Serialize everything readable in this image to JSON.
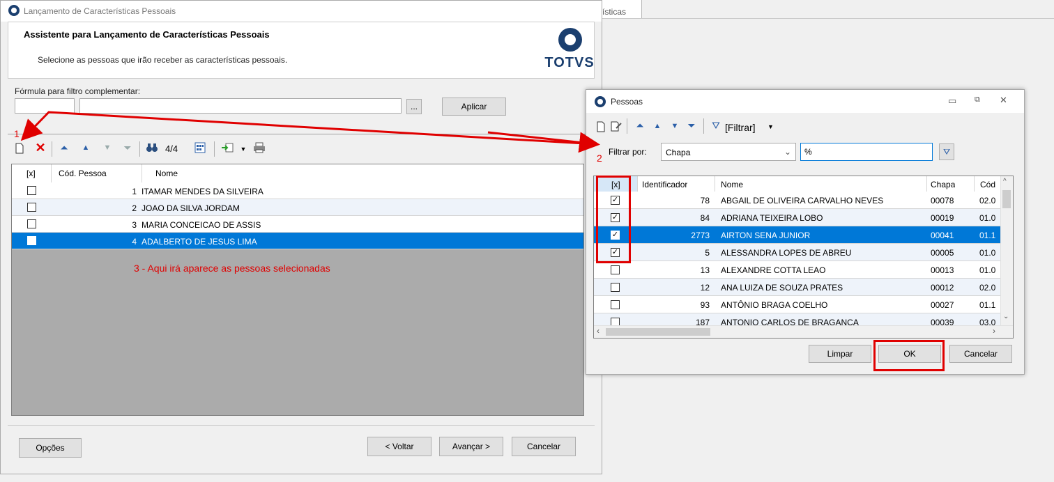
{
  "background": {
    "tab_label": "rísticas"
  },
  "main_window": {
    "title": "Lançamento de Características Pessoais",
    "wizard_title": "Assistente para Lançamento de Características Pessoais",
    "wizard_subtitle": "Selecione as pessoas que irão receber as características pessoais.",
    "logo_text": "TOTVS",
    "formula_label": "Fórmula para filtro complementar:",
    "formula_code_value": "",
    "formula_value": "",
    "ellipsis_label": "...",
    "apply_label": "Aplicar",
    "counter": "4/4",
    "columns": [
      "[x]",
      "Cód. Pessoa",
      "Nome"
    ],
    "rows": [
      {
        "checked": false,
        "code": "1",
        "name": "ITAMAR MENDES DA SILVEIRA"
      },
      {
        "checked": false,
        "code": "2",
        "name": "JOAO DA SILVA JORDAM"
      },
      {
        "checked": false,
        "code": "3",
        "name": "MARIA CONCEICAO DE ASSIS"
      },
      {
        "checked": false,
        "code": "4",
        "name": "ADALBERTO DE JESUS LIMA"
      }
    ],
    "buttons": {
      "options": "Opções",
      "back": "< Voltar",
      "next": "Avançar >",
      "cancel": "Cancelar"
    }
  },
  "dialog": {
    "title": "Pessoas",
    "filter_menu_label": "[Filtrar]",
    "filter_by_label": "Filtrar por:",
    "filter_field_value": "Chapa",
    "filter_text_value": "%",
    "columns": [
      "[x]",
      "Identificador",
      "Nome",
      "Chapa",
      "Cód"
    ],
    "rows": [
      {
        "checked": true,
        "id": "78",
        "name": "ABGAIL DE OLIVEIRA CARVALHO NEVES",
        "chapa": "00078",
        "cod": "02.0"
      },
      {
        "checked": true,
        "id": "84",
        "name": "ADRIANA TEIXEIRA LOBO",
        "chapa": "00019",
        "cod": "01.0"
      },
      {
        "checked": true,
        "id": "2773",
        "name": "AIRTON SENA JUNIOR",
        "chapa": "00041",
        "cod": "01.1"
      },
      {
        "checked": true,
        "id": "5",
        "name": "ALESSANDRA LOPES DE ABREU",
        "chapa": "00005",
        "cod": "01.0"
      },
      {
        "checked": false,
        "id": "13",
        "name": "ALEXANDRE COTTA LEAO",
        "chapa": "00013",
        "cod": "01.0"
      },
      {
        "checked": false,
        "id": "12",
        "name": "ANA LUIZA  DE SOUZA PRATES",
        "chapa": "00012",
        "cod": "02.0"
      },
      {
        "checked": false,
        "id": "93",
        "name": "ANTÔNIO BRAGA COELHO",
        "chapa": "00027",
        "cod": "01.1"
      },
      {
        "checked": false,
        "id": "187",
        "name": "ANTONIO CARLOS DE BRAGANCA",
        "chapa": "00039",
        "cod": "03.0"
      }
    ],
    "buttons": {
      "clear": "Limpar",
      "ok": "OK",
      "cancel": "Cancelar"
    }
  },
  "annotations": {
    "step1": "1",
    "step2": "2",
    "step3": "3 - Aqui irá aparece as pessoas selecionadas",
    "color": "#e00000"
  },
  "colors": {
    "selection": "#0078d7",
    "brand": "#1b3f6f"
  }
}
